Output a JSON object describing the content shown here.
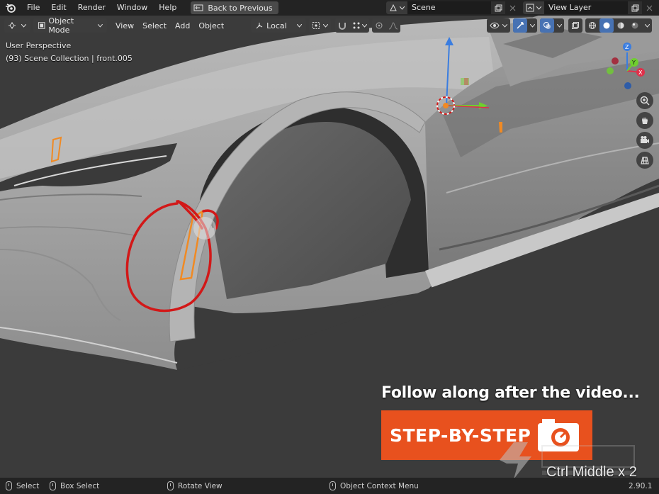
{
  "topbar": {
    "menus": [
      "File",
      "Edit",
      "Render",
      "Window",
      "Help"
    ],
    "back_label": "Back to Previous",
    "scene_name": "Scene",
    "view_layer": "View Layer"
  },
  "header": {
    "mode": "Object Mode",
    "menus": [
      "View",
      "Select",
      "Add",
      "Object"
    ],
    "transform_orientation": "Local"
  },
  "viewport": {
    "perspective": "User Perspective",
    "collection": "(93) Scene Collection | front.005"
  },
  "overlay": {
    "promo_text": "Follow along after the video...",
    "badge_label": "STEP-BY-STEP",
    "shortcut": "Ctrl Middle x 2"
  },
  "statusbar": {
    "select": "Select",
    "box_select": "Box Select",
    "rotate_view": "Rotate View",
    "context_menu": "Object Context Menu",
    "version": "2.90.1"
  },
  "colors": {
    "accent_blue": "#4772b3",
    "promo_orange": "#e8511e",
    "annotation_red": "#d21818",
    "selection_orange": "#f08a24"
  }
}
